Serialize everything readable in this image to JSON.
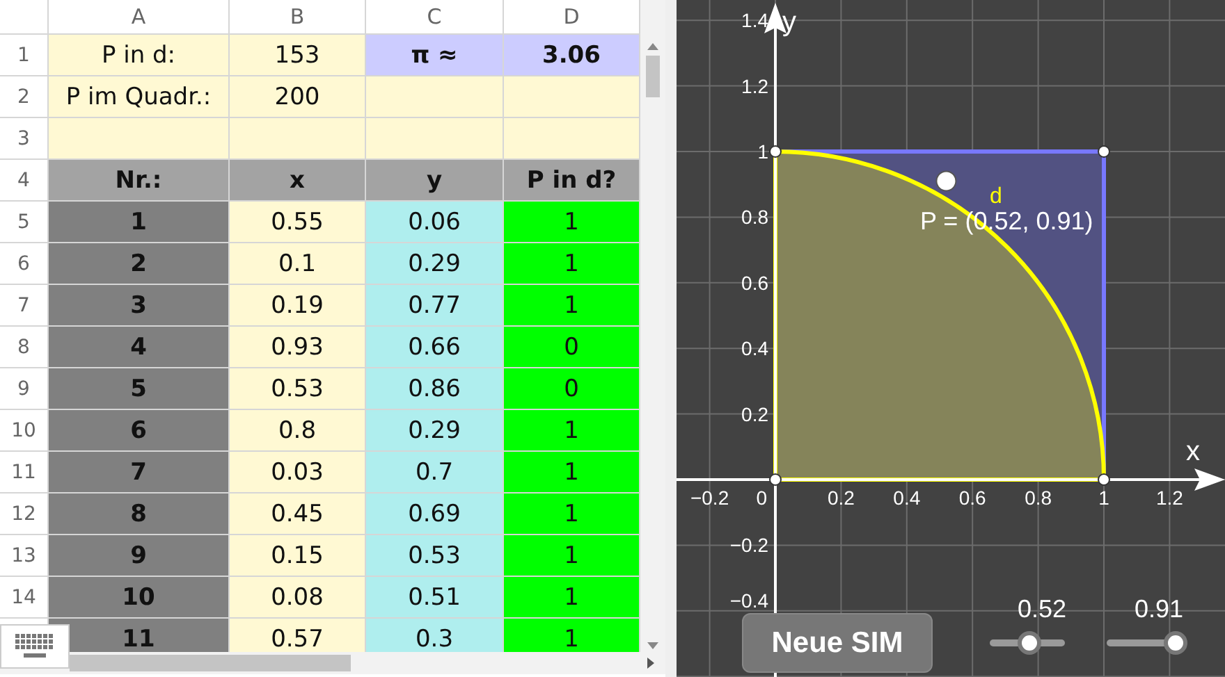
{
  "spreadsheet": {
    "column_headers": [
      "A",
      "B",
      "C",
      "D"
    ],
    "rows": [
      {
        "number": "1",
        "cells": [
          {
            "kind": "label",
            "text": "P in d:"
          },
          {
            "kind": "label",
            "text": "153"
          },
          {
            "kind": "result",
            "text": "π ≈"
          },
          {
            "kind": "result",
            "text": "3.06"
          }
        ]
      },
      {
        "number": "2",
        "cells": [
          {
            "kind": "label",
            "text": "P im Quadr.:"
          },
          {
            "kind": "label",
            "text": "200"
          },
          {
            "kind": "label"
          },
          {
            "kind": "label"
          }
        ]
      },
      {
        "number": "3",
        "cells": [
          {
            "kind": "label"
          },
          {
            "kind": "label"
          },
          {
            "kind": "label"
          },
          {
            "kind": "label"
          }
        ]
      },
      {
        "number": "4",
        "cells": [
          {
            "kind": "header",
            "text": "Nr.:"
          },
          {
            "kind": "header",
            "text": "x"
          },
          {
            "kind": "header",
            "text": "y"
          },
          {
            "kind": "header",
            "text": "P in d?"
          }
        ]
      },
      {
        "number": "5",
        "cells": [
          {
            "kind": "index",
            "text": "1"
          },
          {
            "kind": "x",
            "text": "0.55"
          },
          {
            "kind": "y",
            "text": "0.06"
          },
          {
            "kind": "hit",
            "text": "1"
          }
        ]
      },
      {
        "number": "6",
        "cells": [
          {
            "kind": "index",
            "text": "2"
          },
          {
            "kind": "x",
            "text": "0.1"
          },
          {
            "kind": "y",
            "text": "0.29"
          },
          {
            "kind": "hit",
            "text": "1"
          }
        ]
      },
      {
        "number": "7",
        "cells": [
          {
            "kind": "index",
            "text": "3"
          },
          {
            "kind": "x",
            "text": "0.19"
          },
          {
            "kind": "y",
            "text": "0.77"
          },
          {
            "kind": "hit",
            "text": "1"
          }
        ]
      },
      {
        "number": "8",
        "cells": [
          {
            "kind": "index",
            "text": "4"
          },
          {
            "kind": "x",
            "text": "0.93"
          },
          {
            "kind": "y",
            "text": "0.66"
          },
          {
            "kind": "hit",
            "text": "0"
          }
        ]
      },
      {
        "number": "9",
        "cells": [
          {
            "kind": "index",
            "text": "5"
          },
          {
            "kind": "x",
            "text": "0.53"
          },
          {
            "kind": "y",
            "text": "0.86"
          },
          {
            "kind": "hit",
            "text": "0"
          }
        ]
      },
      {
        "number": "10",
        "cells": [
          {
            "kind": "index",
            "text": "6"
          },
          {
            "kind": "x",
            "text": "0.8"
          },
          {
            "kind": "y",
            "text": "0.29"
          },
          {
            "kind": "hit",
            "text": "1"
          }
        ]
      },
      {
        "number": "11",
        "cells": [
          {
            "kind": "index",
            "text": "7"
          },
          {
            "kind": "x",
            "text": "0.03"
          },
          {
            "kind": "y",
            "text": "0.7"
          },
          {
            "kind": "hit",
            "text": "1"
          }
        ]
      },
      {
        "number": "12",
        "cells": [
          {
            "kind": "index",
            "text": "8"
          },
          {
            "kind": "x",
            "text": "0.45"
          },
          {
            "kind": "y",
            "text": "0.69"
          },
          {
            "kind": "hit",
            "text": "1"
          }
        ]
      },
      {
        "number": "13",
        "cells": [
          {
            "kind": "index",
            "text": "9"
          },
          {
            "kind": "x",
            "text": "0.15"
          },
          {
            "kind": "y",
            "text": "0.53"
          },
          {
            "kind": "hit",
            "text": "1"
          }
        ]
      },
      {
        "number": "14",
        "cells": [
          {
            "kind": "index",
            "text": "10"
          },
          {
            "kind": "x",
            "text": "0.08"
          },
          {
            "kind": "y",
            "text": "0.51"
          },
          {
            "kind": "hit",
            "text": "1"
          }
        ]
      },
      {
        "cells": [
          {
            "kind": "index",
            "text": "11"
          },
          {
            "kind": "x",
            "text": "0.57"
          },
          {
            "kind": "y",
            "text": "0.3"
          },
          {
            "kind": "hit",
            "text": "1"
          }
        ]
      }
    ]
  },
  "graphics": {
    "x_axis_label": "x",
    "y_axis_label": "y",
    "x_ticks": [
      "−0.2",
      "0",
      "0.2",
      "0.4",
      "0.6",
      "0.8",
      "1",
      "1.2"
    ],
    "y_ticks": [
      "1.4",
      "1.2",
      "1",
      "0.8",
      "0.6",
      "0.4",
      "0.2",
      "−0.2",
      "−0.4"
    ],
    "curve_label": "d",
    "point_label": "P = (0.52, 0.91)",
    "button": "Neue SIM",
    "sliders": [
      {
        "reading": "0.52",
        "level": 0.52
      },
      {
        "reading": "0.91",
        "level": 0.91
      }
    ]
  }
}
